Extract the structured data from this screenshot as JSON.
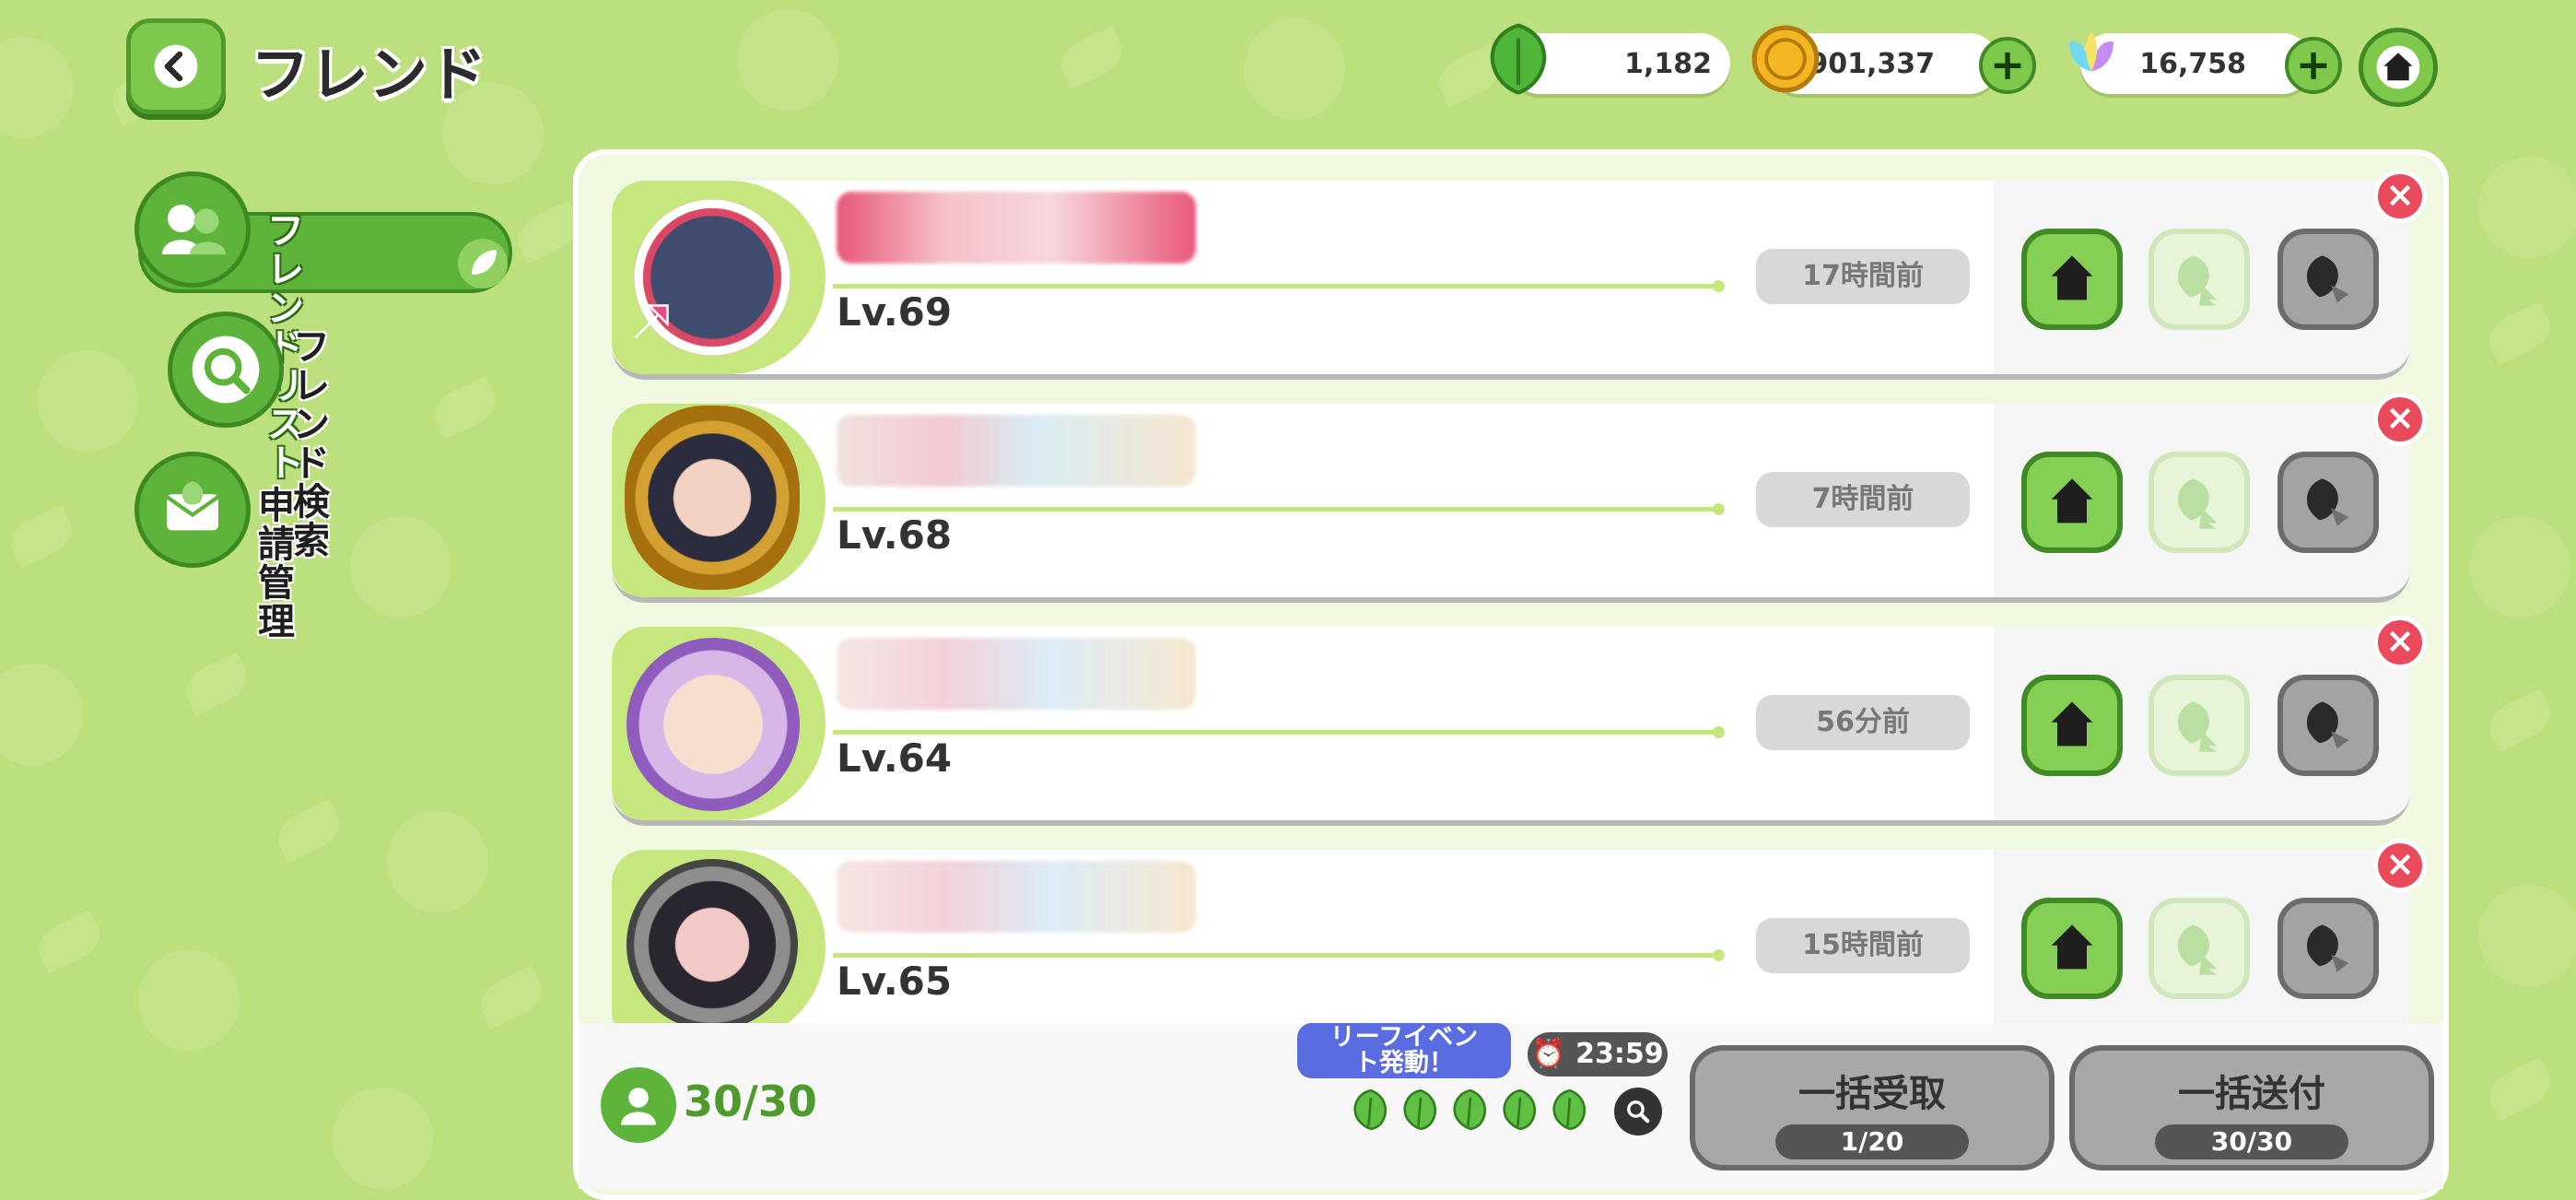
{
  "header": {
    "title": "フレンド",
    "currencies": [
      {
        "icon": "leaf-currency-icon",
        "value": "1,182"
      },
      {
        "icon": "gold-coin-icon",
        "value": "1,901,337"
      },
      {
        "icon": "crystal-gem-icon",
        "value": "16,758"
      }
    ]
  },
  "sidebar": {
    "items": [
      {
        "label_line1": "フレンド",
        "label_line2": "リスト",
        "active": true
      },
      {
        "label_line1": "フレンド",
        "label_line2": "検索",
        "active": false
      },
      {
        "label_line1": "申請管理",
        "label_line2": "",
        "active": false
      }
    ]
  },
  "friends": [
    {
      "level": "Lv.69",
      "last_login": "17時間前"
    },
    {
      "level": "Lv.68",
      "last_login": "7時間前"
    },
    {
      "level": "Lv.64",
      "last_login": "56分前"
    },
    {
      "level": "Lv.65",
      "last_login": "15時間前"
    }
  ],
  "footer": {
    "friend_count": "30/30",
    "event_line1": "リーフイベン",
    "event_line2": "ト発動！",
    "timer": "23:59",
    "leaf_count_filled": 5,
    "receive_all": {
      "label": "一括受取",
      "count": "1/20"
    },
    "send_all": {
      "label": "一括送付",
      "count": "30/30"
    }
  },
  "colors": {
    "background": "#bde07e",
    "accent_green": "#5eb33a",
    "delete_red": "#e94a5c",
    "event_blue": "#5a6de0"
  }
}
